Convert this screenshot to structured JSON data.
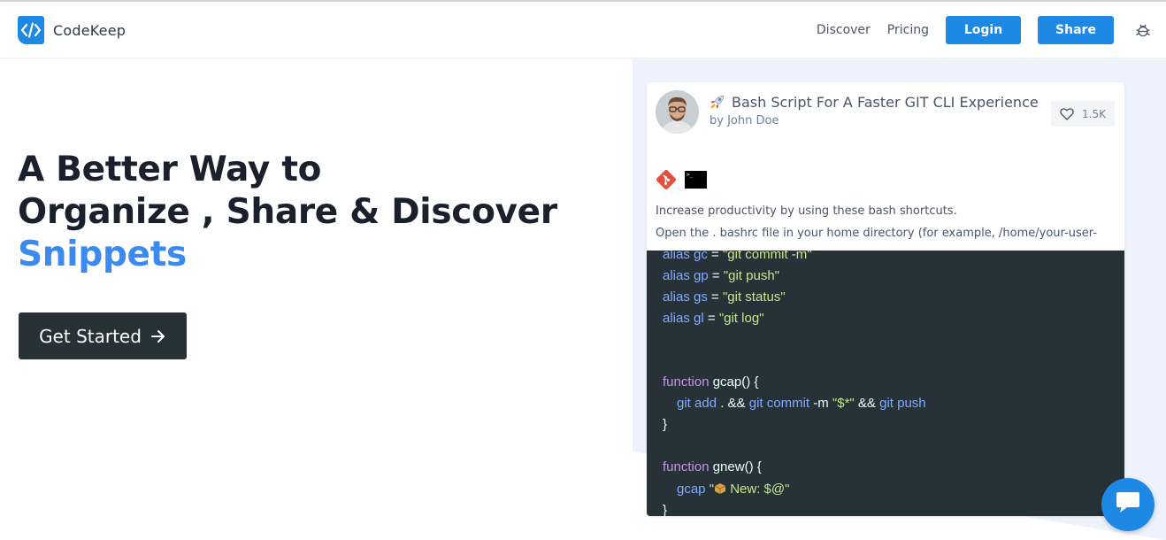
{
  "header": {
    "logo_text": "CodeKeep",
    "nav": {
      "discover": "Discover",
      "pricing": "Pricing"
    },
    "login_label": "Login",
    "share_label": "Share"
  },
  "hero": {
    "line1": "A Better Way to",
    "line2": "Organize , Share & Discover",
    "accent": "Snippets",
    "cta_label": "Get Started"
  },
  "snippet": {
    "title": "Bash Script For A Faster GIT CLI Experience",
    "author": "by John Doe",
    "likes": "1.5K",
    "tags": [
      "git-icon",
      "terminal-icon"
    ],
    "desc_line1": "Increase productivity by using these bash shortcuts.",
    "desc_line2": "Open the . bashrc file in your home directory (for example, /home/your-user-",
    "code": {
      "l1a": "alias gc",
      "l1b": " = ",
      "l1c": "\"git commit -m\"",
      "l2a": "alias gp",
      "l2b": " = ",
      "l2c": "\"git push\"",
      "l3a": "alias gs",
      "l3b": " = ",
      "l3c": "\"git status\"",
      "l4a": "alias gl",
      "l4b": " = ",
      "l4c": "\"git log\"",
      "f1a": "function",
      "f1b": " gcap() {",
      "f1c1": "git add",
      "f1c2": " . && ",
      "f1c3": "git commit",
      "f1c4": " -m ",
      "f1c5": "\"$*\"",
      "f1c6": " && ",
      "f1c7": "git push",
      "f1end": "}",
      "f2a": "function",
      "f2b": " gnew() {",
      "f2c1": "gcap",
      "f2c2": " \"",
      "f2c3": " New: $@\"",
      "f2end": "}"
    }
  },
  "colors": {
    "brand": "#1e88e5",
    "accent": "#3b8aef",
    "code_bg": "#263238",
    "panel_bg": "#edf2fc"
  }
}
